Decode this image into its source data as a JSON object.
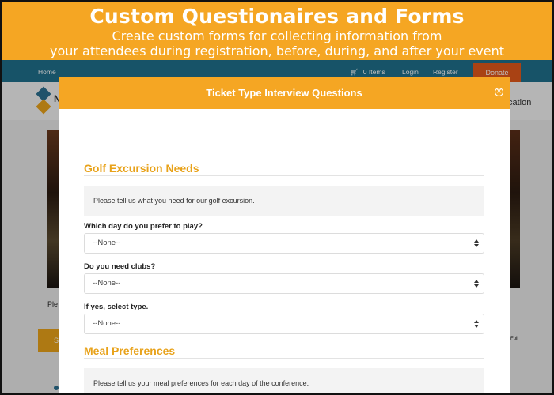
{
  "banner": {
    "title": "Custom Questionaires and Forms",
    "subtitle_line1": "Create custom forms for collecting information from",
    "subtitle_line2": "your attendees during registration, before, during, and after your event"
  },
  "site_nav": {
    "home": "Home",
    "cart_icon": "cart-icon",
    "cart_count": "0 Items",
    "login": "Login",
    "register": "Register",
    "donate": "Donate"
  },
  "site_header": {
    "left_fragment": "N",
    "right_fragment": "cation"
  },
  "background_fragments": {
    "ple": "Ple",
    "orange_button": "S",
    "full": "Full"
  },
  "modal": {
    "title": "Ticket Type Interview Questions",
    "close_icon": "close-circle-icon",
    "sections": [
      {
        "title": "Golf Excursion Needs",
        "info": "Please tell us what you need for our golf excursion.",
        "questions": [
          {
            "label": "Which day do you prefer to play?",
            "value": "--None--"
          },
          {
            "label": "Do you need clubs?",
            "value": "--None--"
          },
          {
            "label": "If yes, select type.",
            "value": "--None--"
          }
        ]
      },
      {
        "title": "Meal Preferences",
        "info": "Please tell us your meal preferences for each day of the conference."
      }
    ]
  },
  "colors": {
    "accent_orange": "#f5a623",
    "section_title": "#e8a21a",
    "nav_teal": "#1f6f8b",
    "donate": "#e2591b"
  }
}
